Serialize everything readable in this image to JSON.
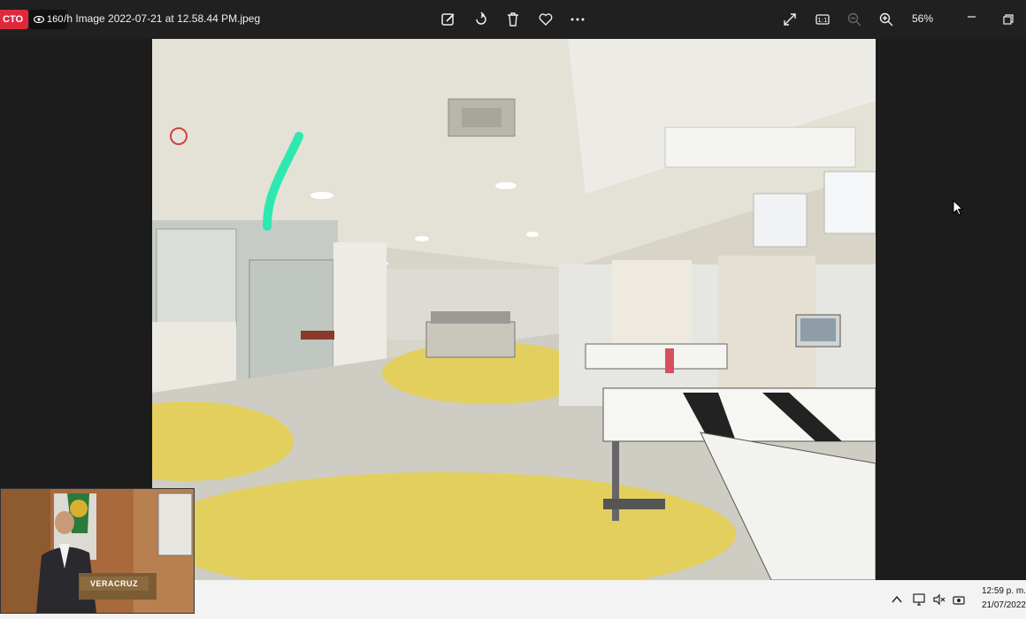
{
  "titlebar": {
    "live_badge": "CTO",
    "viewer_count": "160",
    "filename": "/h Image 2022-07-21 at 12.58.44 PM.jpeg",
    "zoom_level": "56%"
  },
  "icons": {
    "edit": "edit-image-icon",
    "rotate": "rotate-icon",
    "delete": "trash-icon",
    "favorite": "heart-icon",
    "more": "more-icon",
    "fullscreen": "expand-icon",
    "actual_size": "actual-size-icon",
    "zoom_out": "zoom-out-icon",
    "zoom_in": "zoom-in-icon",
    "minimize": "minimize-icon",
    "restore": "restore-icon"
  },
  "taskbar": {
    "time": "12:59 p. m.",
    "date": "21/07/2022"
  },
  "webcam": {
    "podium_label": "VERACRUZ"
  },
  "colors": {
    "accent_live": "#e0283c",
    "annotation_stroke": "#2ee8b0",
    "floor_yellow": "#e2cf5e"
  }
}
